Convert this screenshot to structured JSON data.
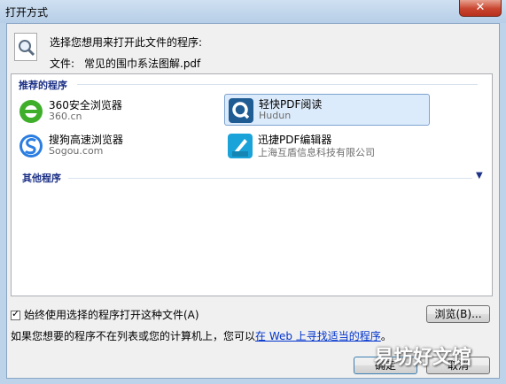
{
  "window": {
    "title": "打开方式",
    "close_glyph": "✕"
  },
  "header": {
    "prompt": "选择您想用来打开此文件的程序:",
    "file_label": "文件:",
    "file_name": "常见的围巾系法图解.pdf"
  },
  "groups": {
    "recommended": {
      "title": "推荐的程序"
    },
    "other": {
      "title": "其他程序"
    }
  },
  "programs": [
    {
      "name": "360安全浏览器",
      "publisher": "360.cn",
      "icon": "360-browser-icon",
      "selected": false
    },
    {
      "name": "轻快PDF阅读",
      "publisher": "Hudun",
      "icon": "qingkuai-pdf-icon",
      "selected": true
    },
    {
      "name": "搜狗高速浏览器",
      "publisher": "Sogou.com",
      "icon": "sogou-browser-icon",
      "selected": false
    },
    {
      "name": "迅捷PDF编辑器",
      "publisher": "上海互盾信息科技有限公司",
      "icon": "xunjie-pdf-icon",
      "selected": false
    }
  ],
  "always_use": {
    "label": "始终使用选择的程序打开这种文件(A)",
    "checked": true,
    "check_glyph": "✓"
  },
  "buttons": {
    "browse": "浏览(B)...",
    "ok": "确定",
    "cancel": "取消"
  },
  "info": {
    "before": "如果您想要的程序不在列表或您的计算机上，您可以",
    "link": "在 Web 上寻找适当的程序",
    "after": "。"
  },
  "watermark": "易坊好文馆",
  "colors": {
    "accent": "#1e3287",
    "link": "#0033cc",
    "selection": "#dcebfc"
  }
}
